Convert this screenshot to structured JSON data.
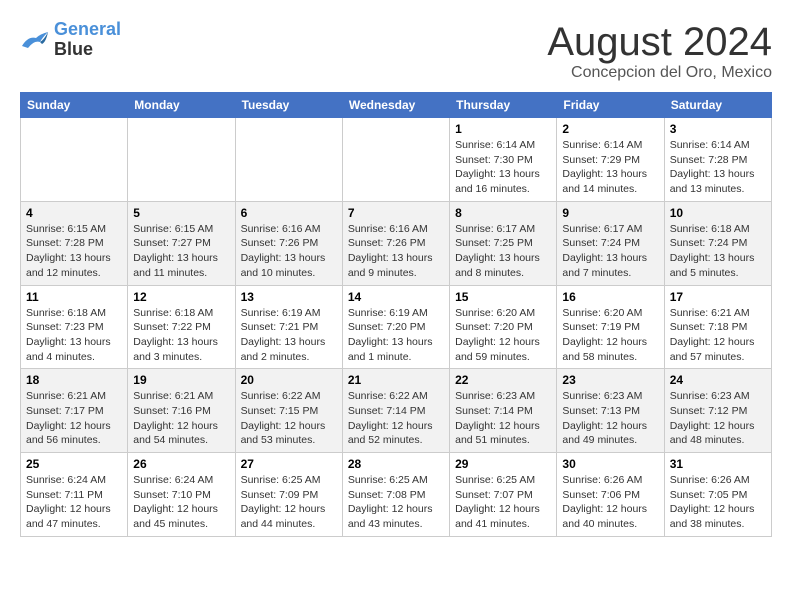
{
  "logo": {
    "line1": "General",
    "line2": "Blue"
  },
  "title": "August 2024",
  "location": "Concepcion del Oro, Mexico",
  "weekdays": [
    "Sunday",
    "Monday",
    "Tuesday",
    "Wednesday",
    "Thursday",
    "Friday",
    "Saturday"
  ],
  "weeks": [
    [
      {
        "day": "",
        "info": ""
      },
      {
        "day": "",
        "info": ""
      },
      {
        "day": "",
        "info": ""
      },
      {
        "day": "",
        "info": ""
      },
      {
        "day": "1",
        "info": "Sunrise: 6:14 AM\nSunset: 7:30 PM\nDaylight: 13 hours\nand 16 minutes."
      },
      {
        "day": "2",
        "info": "Sunrise: 6:14 AM\nSunset: 7:29 PM\nDaylight: 13 hours\nand 14 minutes."
      },
      {
        "day": "3",
        "info": "Sunrise: 6:14 AM\nSunset: 7:28 PM\nDaylight: 13 hours\nand 13 minutes."
      }
    ],
    [
      {
        "day": "4",
        "info": "Sunrise: 6:15 AM\nSunset: 7:28 PM\nDaylight: 13 hours\nand 12 minutes."
      },
      {
        "day": "5",
        "info": "Sunrise: 6:15 AM\nSunset: 7:27 PM\nDaylight: 13 hours\nand 11 minutes."
      },
      {
        "day": "6",
        "info": "Sunrise: 6:16 AM\nSunset: 7:26 PM\nDaylight: 13 hours\nand 10 minutes."
      },
      {
        "day": "7",
        "info": "Sunrise: 6:16 AM\nSunset: 7:26 PM\nDaylight: 13 hours\nand 9 minutes."
      },
      {
        "day": "8",
        "info": "Sunrise: 6:17 AM\nSunset: 7:25 PM\nDaylight: 13 hours\nand 8 minutes."
      },
      {
        "day": "9",
        "info": "Sunrise: 6:17 AM\nSunset: 7:24 PM\nDaylight: 13 hours\nand 7 minutes."
      },
      {
        "day": "10",
        "info": "Sunrise: 6:18 AM\nSunset: 7:24 PM\nDaylight: 13 hours\nand 5 minutes."
      }
    ],
    [
      {
        "day": "11",
        "info": "Sunrise: 6:18 AM\nSunset: 7:23 PM\nDaylight: 13 hours\nand 4 minutes."
      },
      {
        "day": "12",
        "info": "Sunrise: 6:18 AM\nSunset: 7:22 PM\nDaylight: 13 hours\nand 3 minutes."
      },
      {
        "day": "13",
        "info": "Sunrise: 6:19 AM\nSunset: 7:21 PM\nDaylight: 13 hours\nand 2 minutes."
      },
      {
        "day": "14",
        "info": "Sunrise: 6:19 AM\nSunset: 7:20 PM\nDaylight: 13 hours\nand 1 minute."
      },
      {
        "day": "15",
        "info": "Sunrise: 6:20 AM\nSunset: 7:20 PM\nDaylight: 12 hours\nand 59 minutes."
      },
      {
        "day": "16",
        "info": "Sunrise: 6:20 AM\nSunset: 7:19 PM\nDaylight: 12 hours\nand 58 minutes."
      },
      {
        "day": "17",
        "info": "Sunrise: 6:21 AM\nSunset: 7:18 PM\nDaylight: 12 hours\nand 57 minutes."
      }
    ],
    [
      {
        "day": "18",
        "info": "Sunrise: 6:21 AM\nSunset: 7:17 PM\nDaylight: 12 hours\nand 56 minutes."
      },
      {
        "day": "19",
        "info": "Sunrise: 6:21 AM\nSunset: 7:16 PM\nDaylight: 12 hours\nand 54 minutes."
      },
      {
        "day": "20",
        "info": "Sunrise: 6:22 AM\nSunset: 7:15 PM\nDaylight: 12 hours\nand 53 minutes."
      },
      {
        "day": "21",
        "info": "Sunrise: 6:22 AM\nSunset: 7:14 PM\nDaylight: 12 hours\nand 52 minutes."
      },
      {
        "day": "22",
        "info": "Sunrise: 6:23 AM\nSunset: 7:14 PM\nDaylight: 12 hours\nand 51 minutes."
      },
      {
        "day": "23",
        "info": "Sunrise: 6:23 AM\nSunset: 7:13 PM\nDaylight: 12 hours\nand 49 minutes."
      },
      {
        "day": "24",
        "info": "Sunrise: 6:23 AM\nSunset: 7:12 PM\nDaylight: 12 hours\nand 48 minutes."
      }
    ],
    [
      {
        "day": "25",
        "info": "Sunrise: 6:24 AM\nSunset: 7:11 PM\nDaylight: 12 hours\nand 47 minutes."
      },
      {
        "day": "26",
        "info": "Sunrise: 6:24 AM\nSunset: 7:10 PM\nDaylight: 12 hours\nand 45 minutes."
      },
      {
        "day": "27",
        "info": "Sunrise: 6:25 AM\nSunset: 7:09 PM\nDaylight: 12 hours\nand 44 minutes."
      },
      {
        "day": "28",
        "info": "Sunrise: 6:25 AM\nSunset: 7:08 PM\nDaylight: 12 hours\nand 43 minutes."
      },
      {
        "day": "29",
        "info": "Sunrise: 6:25 AM\nSunset: 7:07 PM\nDaylight: 12 hours\nand 41 minutes."
      },
      {
        "day": "30",
        "info": "Sunrise: 6:26 AM\nSunset: 7:06 PM\nDaylight: 12 hours\nand 40 minutes."
      },
      {
        "day": "31",
        "info": "Sunrise: 6:26 AM\nSunset: 7:05 PM\nDaylight: 12 hours\nand 38 minutes."
      }
    ]
  ]
}
